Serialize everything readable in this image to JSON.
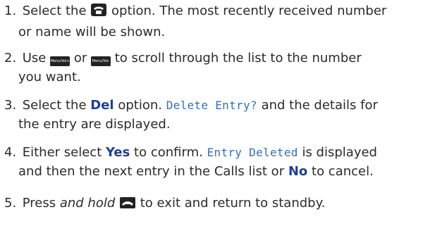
{
  "steps": [
    {
      "number": "1.",
      "text_before": "Select the",
      "icon": "calls-list-phone-icon",
      "text_after": "option. The most recently received number",
      "line2": "or name will be shown."
    },
    {
      "number": "2.",
      "text_before": "Use",
      "key1_label": "Menu/Vol+",
      "or": "or",
      "key2_label": "Menu/Vol-",
      "text_after": "to scroll through the list to the number",
      "line2": "you want."
    },
    {
      "number": "3.",
      "text_before": "Select the",
      "bold": "Del",
      "text_mid": "option.",
      "lcd": "Delete Entry?",
      "text_after": "and the details for",
      "line2": "the entry are displayed."
    },
    {
      "number": "4.",
      "text_before": "Either select",
      "bold1": "Yes",
      "text_mid": "to confirm.",
      "lcd": "Entry Deleted",
      "text_after": "is displayed",
      "line2_before": "and then the next entry in the Calls list or",
      "bold2": "No",
      "line2_after": "to cancel."
    },
    {
      "number": "5.",
      "text_before": "Press",
      "italic": "and hold",
      "icon": "end-call-icon",
      "text_after": "to exit and return to standby."
    }
  ],
  "colors": {
    "text": "#2b2b2b",
    "bold_blue": "#1f3f95",
    "lcd_blue": "#2f6fc2"
  }
}
